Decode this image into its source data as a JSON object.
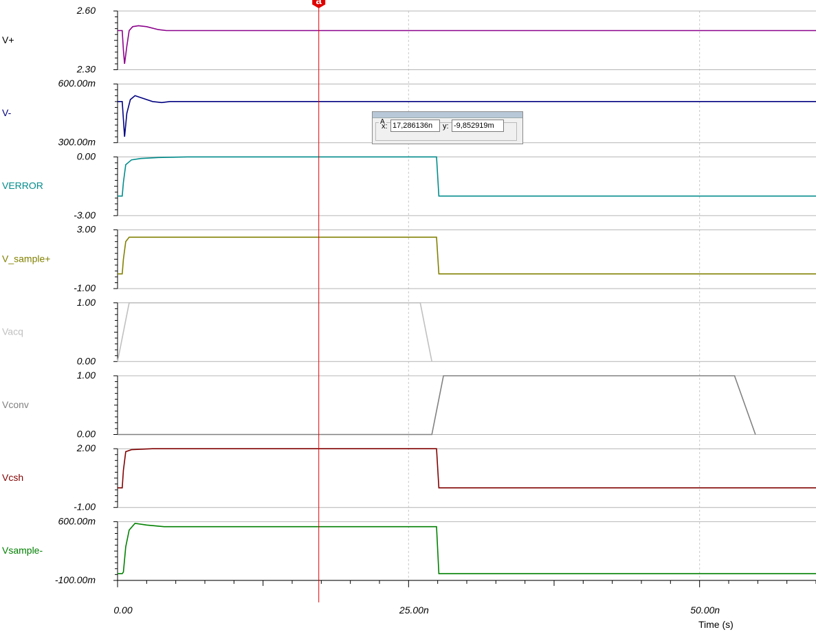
{
  "chart_data": {
    "type": "line",
    "x_axis": {
      "title": "Time (s)",
      "range": [
        0,
        6e-08
      ],
      "tick_labels": [
        "0.00",
        "25.00n",
        "50.00n"
      ],
      "tick_values": [
        0,
        2.5e-08,
        5e-08
      ],
      "grid": true
    },
    "cursor": {
      "name": "a",
      "x": 1.7286136e-08,
      "color": "#e00000",
      "readout_x_label": "x:",
      "readout_y_label": "y:",
      "readout_x": "17,286136n",
      "readout_y": "-9,852919m",
      "panel_label": "A"
    },
    "series": [
      {
        "name": "V+",
        "color": "#8b008b",
        "labelColor": "#000000",
        "ylim": [
          2.3,
          2.6
        ],
        "ytick_labels": [
          "2.60",
          "2.30"
        ],
        "points": [
          [
            0,
            2.5
          ],
          [
            4e-10,
            2.5
          ],
          [
            5e-10,
            2.4
          ],
          [
            6e-10,
            2.33
          ],
          [
            8e-10,
            2.42
          ],
          [
            1e-09,
            2.5
          ],
          [
            1.3e-09,
            2.52
          ],
          [
            1.8e-09,
            2.525
          ],
          [
            2.5e-09,
            2.52
          ],
          [
            3.5e-09,
            2.505
          ],
          [
            4.2e-09,
            2.5
          ],
          [
            6e-08,
            2.5
          ]
        ]
      },
      {
        "name": "V-",
        "color": "#000080",
        "labelColor": "#000080",
        "ylim": [
          0.3,
          0.6
        ],
        "ytick_labels": [
          "600.00m",
          "300.00m"
        ],
        "points": [
          [
            0,
            0.51
          ],
          [
            4e-10,
            0.51
          ],
          [
            5e-10,
            0.42
          ],
          [
            6e-10,
            0.33
          ],
          [
            8e-10,
            0.45
          ],
          [
            1.1e-09,
            0.52
          ],
          [
            1.5e-09,
            0.54
          ],
          [
            2e-09,
            0.53
          ],
          [
            3e-09,
            0.51
          ],
          [
            3.8e-09,
            0.505
          ],
          [
            4.5e-09,
            0.51
          ],
          [
            6e-08,
            0.51
          ]
        ]
      },
      {
        "name": "VERROR",
        "color": "#008b8b",
        "labelColor": "#008b8b",
        "ylim": [
          -3,
          0
        ],
        "ytick_labels": [
          "0.00",
          "-3.00"
        ],
        "points": [
          [
            0,
            -2
          ],
          [
            4e-10,
            -2
          ],
          [
            5e-10,
            -1.3
          ],
          [
            7e-10,
            -0.4
          ],
          [
            1.2e-09,
            -0.15
          ],
          [
            2e-09,
            -0.08
          ],
          [
            3.5e-09,
            -0.03
          ],
          [
            6e-09,
            0
          ],
          [
            2.74e-08,
            0
          ],
          [
            2.76e-08,
            -2
          ],
          [
            6e-08,
            -2
          ]
        ]
      },
      {
        "name": "V_sample+",
        "color": "#808000",
        "labelColor": "#808000",
        "ylim": [
          -1,
          3
        ],
        "ytick_labels": [
          "3.00",
          "-1.00"
        ],
        "points": [
          [
            0,
            0
          ],
          [
            4e-10,
            0
          ],
          [
            5e-10,
            1.0
          ],
          [
            7e-10,
            2.2
          ],
          [
            1e-09,
            2.5
          ],
          [
            1.5e-09,
            2.5
          ],
          [
            2.74e-08,
            2.5
          ],
          [
            2.76e-08,
            0
          ],
          [
            6e-08,
            0
          ]
        ]
      },
      {
        "name": "Vacq",
        "color": "#c0c0c0",
        "labelColor": "#c0c0c0",
        "ylim": [
          0,
          1
        ],
        "ytick_labels": [
          "1.00",
          "0.00"
        ],
        "points": [
          [
            0,
            0
          ],
          [
            1e-09,
            1
          ],
          [
            2.6e-08,
            1
          ],
          [
            2.7e-08,
            0
          ]
        ]
      },
      {
        "name": "Vconv",
        "color": "#808080",
        "labelColor": "#808080",
        "ylim": [
          0,
          1
        ],
        "ytick_labels": [
          "1.00",
          "0.00"
        ],
        "points": [
          [
            0,
            0
          ],
          [
            2.7e-08,
            0
          ],
          [
            2.8e-08,
            1
          ],
          [
            5.3e-08,
            1
          ],
          [
            5.48e-08,
            0
          ]
        ]
      },
      {
        "name": "Vcsh",
        "color": "#800000",
        "labelColor": "#800000",
        "ylim": [
          -1,
          2
        ],
        "ytick_labels": [
          "2.00",
          "-1.00"
        ],
        "points": [
          [
            0,
            0
          ],
          [
            4e-10,
            0
          ],
          [
            5e-10,
            0.9
          ],
          [
            7e-10,
            1.85
          ],
          [
            1.2e-09,
            1.95
          ],
          [
            3e-09,
            2
          ],
          [
            2.74e-08,
            2
          ],
          [
            2.76e-08,
            0
          ],
          [
            6e-08,
            0
          ]
        ]
      },
      {
        "name": "Vsample-",
        "color": "#008000",
        "labelColor": "#008000",
        "ylim": [
          -0.1,
          0.6
        ],
        "ytick_labels": [
          "600.00m",
          "-100.00m"
        ],
        "points": [
          [
            0,
            -0.02
          ],
          [
            4e-10,
            -0.02
          ],
          [
            5e-10,
            0.0
          ],
          [
            7e-10,
            0.3
          ],
          [
            1e-09,
            0.5
          ],
          [
            1.5e-09,
            0.58
          ],
          [
            2.5e-09,
            0.56
          ],
          [
            4e-09,
            0.54
          ],
          [
            2.74e-08,
            0.54
          ],
          [
            2.76e-08,
            -0.02
          ],
          [
            6e-08,
            -0.02
          ]
        ]
      }
    ]
  }
}
